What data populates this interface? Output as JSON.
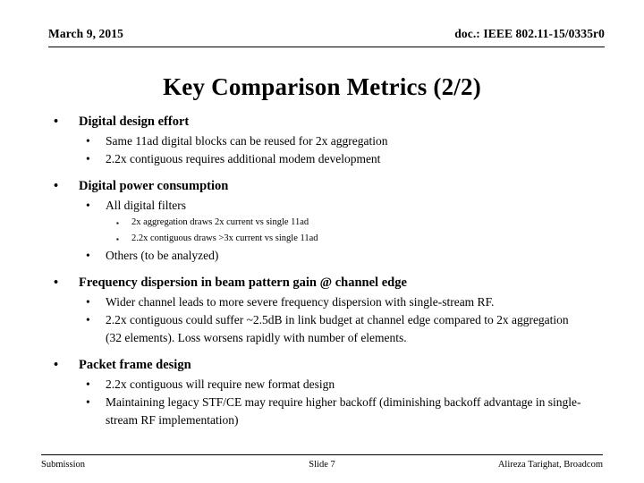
{
  "header": {
    "date": "March 9, 2015",
    "doc": "doc.: IEEE 802.11-15/0335r0"
  },
  "title": "Key Comparison Metrics (2/2)",
  "bullets": {
    "round_marker": "•",
    "square_marker": "▪"
  },
  "sections": [
    {
      "heading": "Digital design effort",
      "items": [
        {
          "level": 2,
          "text": "Same 11ad digital blocks can be reused for 2x aggregation"
        },
        {
          "level": 2,
          "text": "2.2x contiguous requires additional modem development"
        }
      ]
    },
    {
      "heading": "Digital power consumption",
      "items": [
        {
          "level": 2,
          "text": "All digital filters"
        },
        {
          "level": 3,
          "text": "2x aggregation draws 2x current vs single 11ad"
        },
        {
          "level": 3,
          "text": "2.2x contiguous draws >3x current vs single 11ad"
        },
        {
          "level": 2,
          "text": "Others (to be analyzed)"
        }
      ]
    },
    {
      "heading": "Frequency dispersion in beam pattern gain @ channel edge",
      "items": [
        {
          "level": 2,
          "text": "Wider channel leads to more severe frequency dispersion with single-stream RF."
        },
        {
          "level": 2,
          "text": "2.2x contiguous could suffer ~2.5dB in link budget at channel edge compared to 2x aggregation (32 elements). Loss worsens rapidly with number of elements."
        }
      ]
    },
    {
      "heading": "Packet frame design",
      "items": [
        {
          "level": 2,
          "text": "2.2x contiguous will require new format design"
        },
        {
          "level": 2,
          "text": "Maintaining legacy STF/CE may require higher backoff (diminishing backoff advantage in single-stream RF implementation)"
        }
      ]
    }
  ],
  "footer": {
    "left": "Submission",
    "center": "Slide 7",
    "right": "Alireza Tarighat, Broadcom"
  }
}
